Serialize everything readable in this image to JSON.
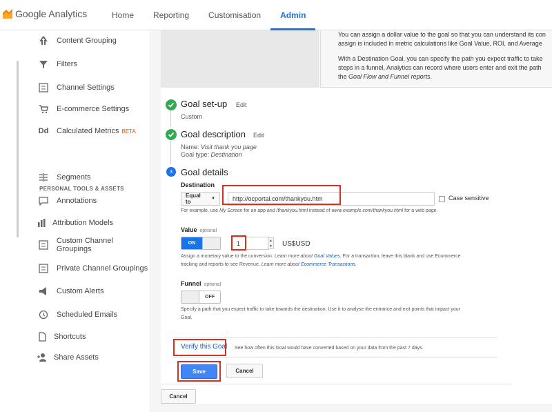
{
  "app": {
    "title": "Google Analytics"
  },
  "nav": [
    "Home",
    "Reporting",
    "Customisation",
    "Admin"
  ],
  "sidebar": {
    "items_top": [
      {
        "label": "Content Grouping",
        "icon": "content-grouping-icon"
      },
      {
        "label": "Filters",
        "icon": "filter-icon"
      },
      {
        "label": "Channel Settings",
        "icon": "channel-settings-icon"
      },
      {
        "label": "E-commerce Settings",
        "icon": "cart-icon"
      },
      {
        "label": "Calculated Metrics",
        "icon": "dd-icon",
        "badge": "BETA"
      }
    ],
    "section_title": "PERSONAL TOOLS & ASSETS",
    "items_bottom": [
      {
        "label": "Segments",
        "icon": "segments-icon"
      },
      {
        "label": "Annotations",
        "icon": "annotations-icon"
      },
      {
        "label": "Attribution Models",
        "icon": "bar-chart-icon"
      },
      {
        "label": "Custom Channel Groupings",
        "icon": "channel-groupings-icon"
      },
      {
        "label": "Private Channel Groupings",
        "icon": "channel-groupings-icon"
      },
      {
        "label": "Custom Alerts",
        "icon": "megaphone-icon"
      },
      {
        "label": "Scheduled Emails",
        "icon": "clock-icon"
      },
      {
        "label": "Shortcuts",
        "icon": "document-icon"
      },
      {
        "label": "Share Assets",
        "icon": "add-person-icon"
      }
    ]
  },
  "description": {
    "line1": "You can assign a dollar value to the goal so that you can understand its con",
    "line2": "assign is included in metric calculations like Goal Value, ROI, and Average",
    "line3": "With a Destination Goal, you can specify the path you expect traffic to take",
    "line4": "steps in a funnel, Analytics can record where users enter and exit the path",
    "line5_prefix": "the ",
    "line5_italic": "Goal Flow and Funnel reports",
    "line5_suffix": "."
  },
  "goal_setup": {
    "title": "Goal set-up",
    "edit": "Edit",
    "value": "Custom"
  },
  "goal_description": {
    "title": "Goal description",
    "edit": "Edit",
    "name_label": "Name:",
    "name_value": "Visit thank you page",
    "type_label": "Goal type:",
    "type_value": "Destination"
  },
  "goal_details": {
    "step_number": "3",
    "title": "Goal details",
    "destination_label": "Destination",
    "match_type": "Equal to",
    "destination_value": "http://ocportal.com/thankyou.htm",
    "case_sensitive": "Case sensitive",
    "destination_hint_a": "For example, use ",
    "destination_hint_b": "My Screen",
    "destination_hint_c": " for an app and ",
    "destination_hint_d": "/thankyou.html",
    "destination_hint_e": " instead of ",
    "destination_hint_f": "www.example.com/thankyou.html",
    "destination_hint_g": " for a web page.",
    "value_label": "Value",
    "optional": "optional",
    "value_toggle": "ON",
    "value_amount": "1",
    "currency": "US$USD",
    "value_hint_a": "Assign a monetary value to the conversion. ",
    "value_hint_b": "Learn more about ",
    "value_hint_c": "Goal Values",
    "value_hint_d": ". For a transaction, leave this blank and use Ecommerce",
    "value_hint_e": "tracking and reports to see Revenue. ",
    "value_hint_f": "Learn more about ",
    "value_hint_g": "Ecommerce Transactions",
    "value_hint_h": ".",
    "funnel_label": "Funnel",
    "funnel_toggle": "OFF",
    "funnel_hint_1": "Specify a path that you expect traffic to take towards the destination. Use it to analyse the entrance and exit points that impact your",
    "funnel_hint_2": "Goal.",
    "verify_link": "Verify this Goal",
    "verify_hint": "See how often this Goal would have converted based on your data from the past 7 days.",
    "save": "Save",
    "cancel": "Cancel"
  },
  "footer_cancel": "Cancel"
}
